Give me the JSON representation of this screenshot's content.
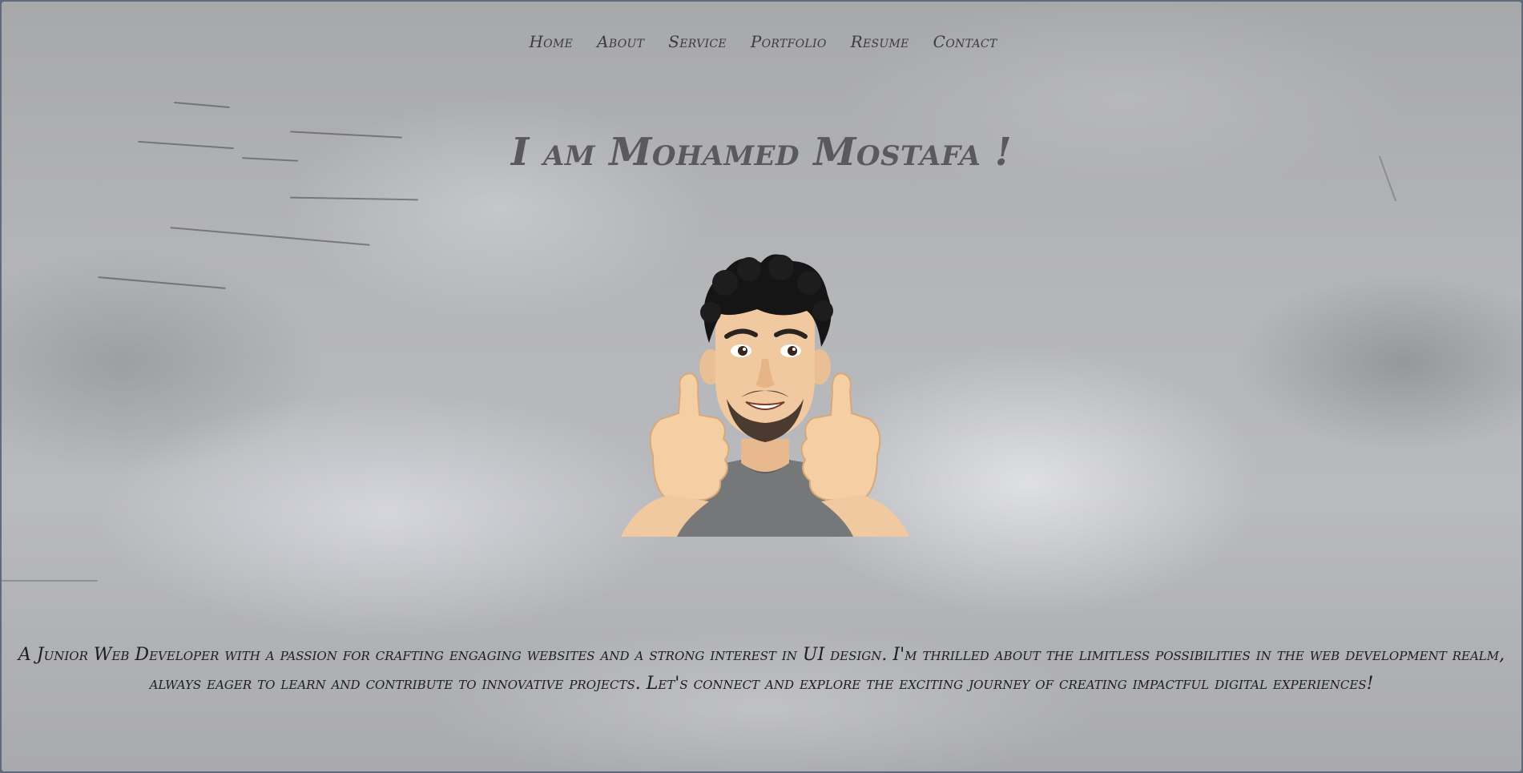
{
  "nav": {
    "items": [
      {
        "label": "Home"
      },
      {
        "label": "About"
      },
      {
        "label": "Service"
      },
      {
        "label": "Portfolio"
      },
      {
        "label": "Resume"
      },
      {
        "label": "Contact"
      }
    ]
  },
  "hero": {
    "title": "I am Mohamed Mostafa !",
    "avatar_icon": "thumbs-up-avatar-icon"
  },
  "bio": {
    "text": "A Junior Web Developer with a passion for crafting engaging websites and a strong interest in UI design. I'm thrilled about the limitless possibilities in the web development realm, always eager to learn and contribute to innovative projects. Let's connect and explore the exciting journey of creating impactful digital experiences!"
  },
  "colors": {
    "background": "#b4b5b8",
    "nav_text": "#3c3c3e",
    "title_text": "#5a5a5c",
    "body_text": "#1e1e1f"
  }
}
